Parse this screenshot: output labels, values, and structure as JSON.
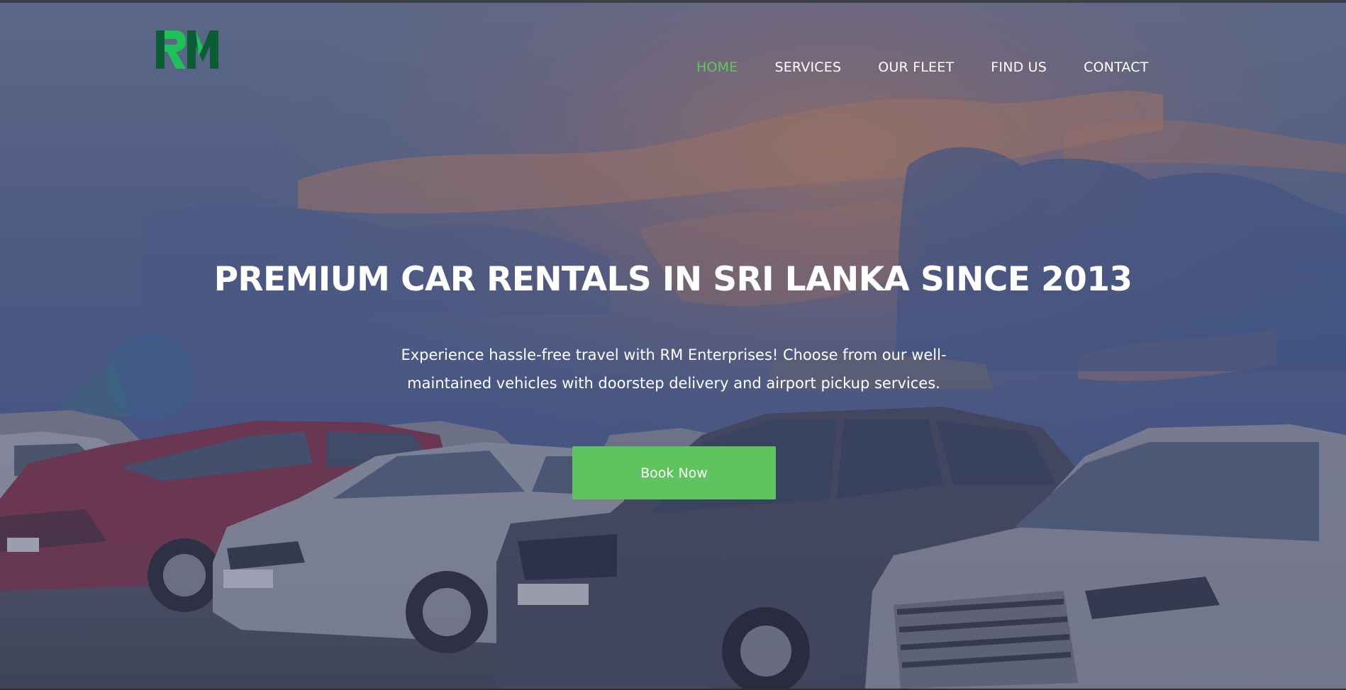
{
  "brand": {
    "logo_text": "RM",
    "logo_colors": {
      "dark_green": "#0a5c34",
      "bright_green": "#1fbf5a"
    }
  },
  "nav": {
    "items": [
      {
        "label": "HOME",
        "active": true
      },
      {
        "label": "SERVICES",
        "active": false
      },
      {
        "label": "OUR FLEET",
        "active": false
      },
      {
        "label": "FIND US",
        "active": false
      },
      {
        "label": "CONTACT",
        "active": false
      }
    ],
    "active_color": "#5ec85f",
    "default_color": "#ffffff"
  },
  "hero": {
    "title": "PREMIUM CAR RENTALS IN SRI LANKA SINCE 2013",
    "subtitle_line1": "Experience hassle-free travel with RM Enterprises! Choose from our well-",
    "subtitle_line2": "maintained vehicles with doorstep delivery and airport pickup services.",
    "cta_label": "Book Now",
    "cta_color": "#5fc45f",
    "background_image": "cars-parked-under-sunset-sky"
  }
}
